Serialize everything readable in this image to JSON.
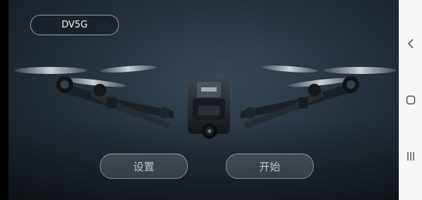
{
  "network": {
    "label": "DV5G"
  },
  "buttons": {
    "settings": "设置",
    "start": "开始"
  },
  "nav": {
    "back": "back-icon",
    "home": "home-icon",
    "recents": "recents-icon"
  },
  "colors": {
    "background": "#26313c",
    "navbar": "#f7f7f7",
    "button": "#6e767e"
  }
}
